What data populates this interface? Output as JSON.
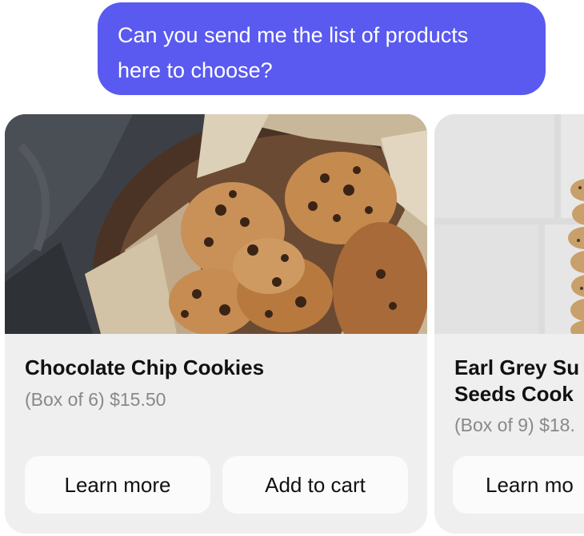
{
  "message": {
    "line1": "Can you send me the list of products",
    "line2": "here to choose?"
  },
  "products": [
    {
      "title": "Chocolate Chip Cookies",
      "meta": "(Box of 6) $15.50",
      "learn_label": "Learn more",
      "cart_label": "Add to cart"
    },
    {
      "title_line1": "Earl Grey Su",
      "title_line2": "Seeds Cook",
      "meta": "(Box of 9) $18.",
      "learn_label": "Learn mo"
    }
  ],
  "colors": {
    "bubble": "#5a5af0",
    "card": "#efefef",
    "button": "#fbfbfb"
  }
}
